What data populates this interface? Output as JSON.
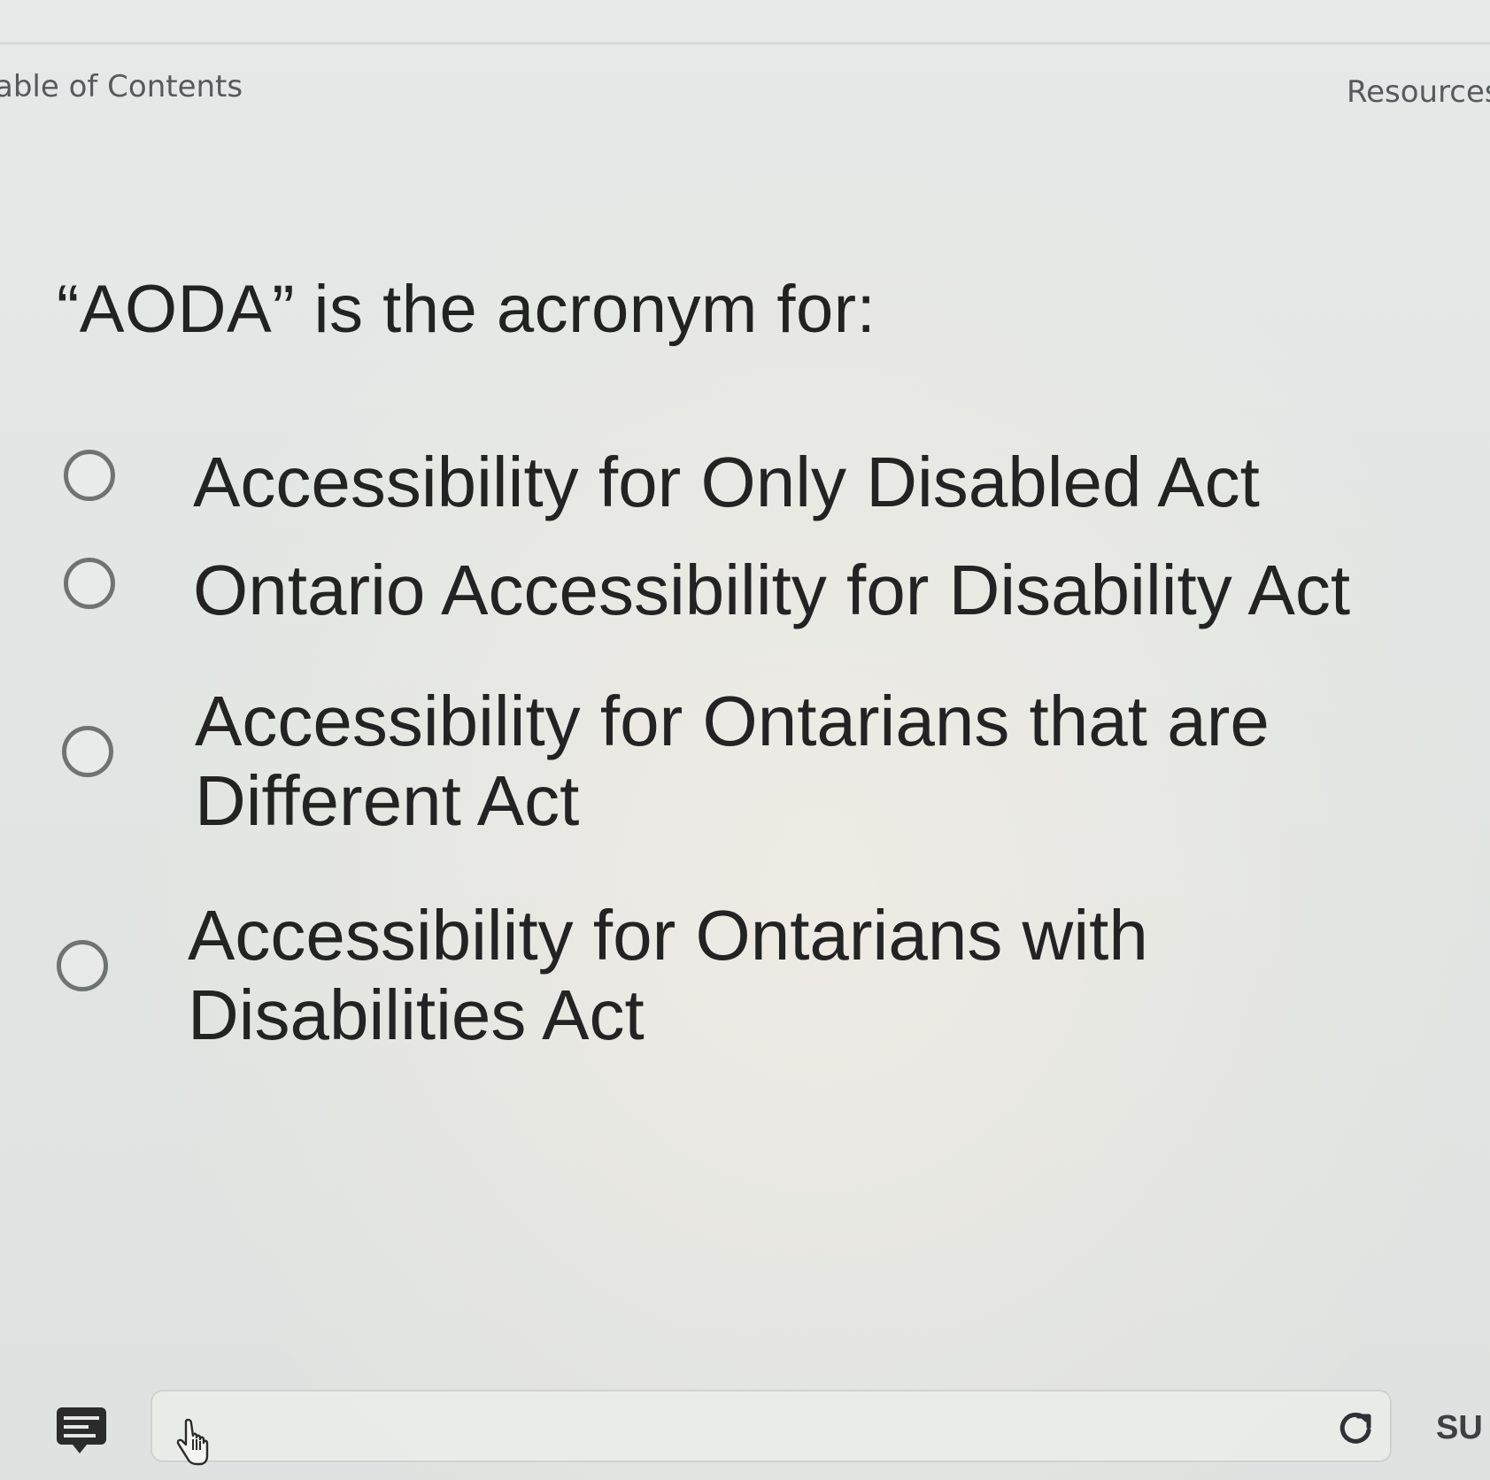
{
  "header": {
    "toc_label": "able of Contents",
    "resources_label": "Resources"
  },
  "question": {
    "text": "“AODA” is the acronym for:"
  },
  "options": [
    {
      "lines": [
        "Accessibility for Only Disabled Act"
      ],
      "selected": false
    },
    {
      "lines": [
        "Ontario Accessibility for Disability Act"
      ],
      "selected": false
    },
    {
      "lines": [
        "Accessibility for Ontarians that are",
        "Different Act"
      ],
      "selected": false
    },
    {
      "lines": [
        "Accessibility for Ontarians with",
        "Disabilities Act"
      ],
      "selected": false
    }
  ],
  "footer": {
    "submit_label": "SU",
    "comment_icon": "comment-icon",
    "refresh_icon": "refresh-icon",
    "cursor_icon": "hand-cursor-icon"
  }
}
